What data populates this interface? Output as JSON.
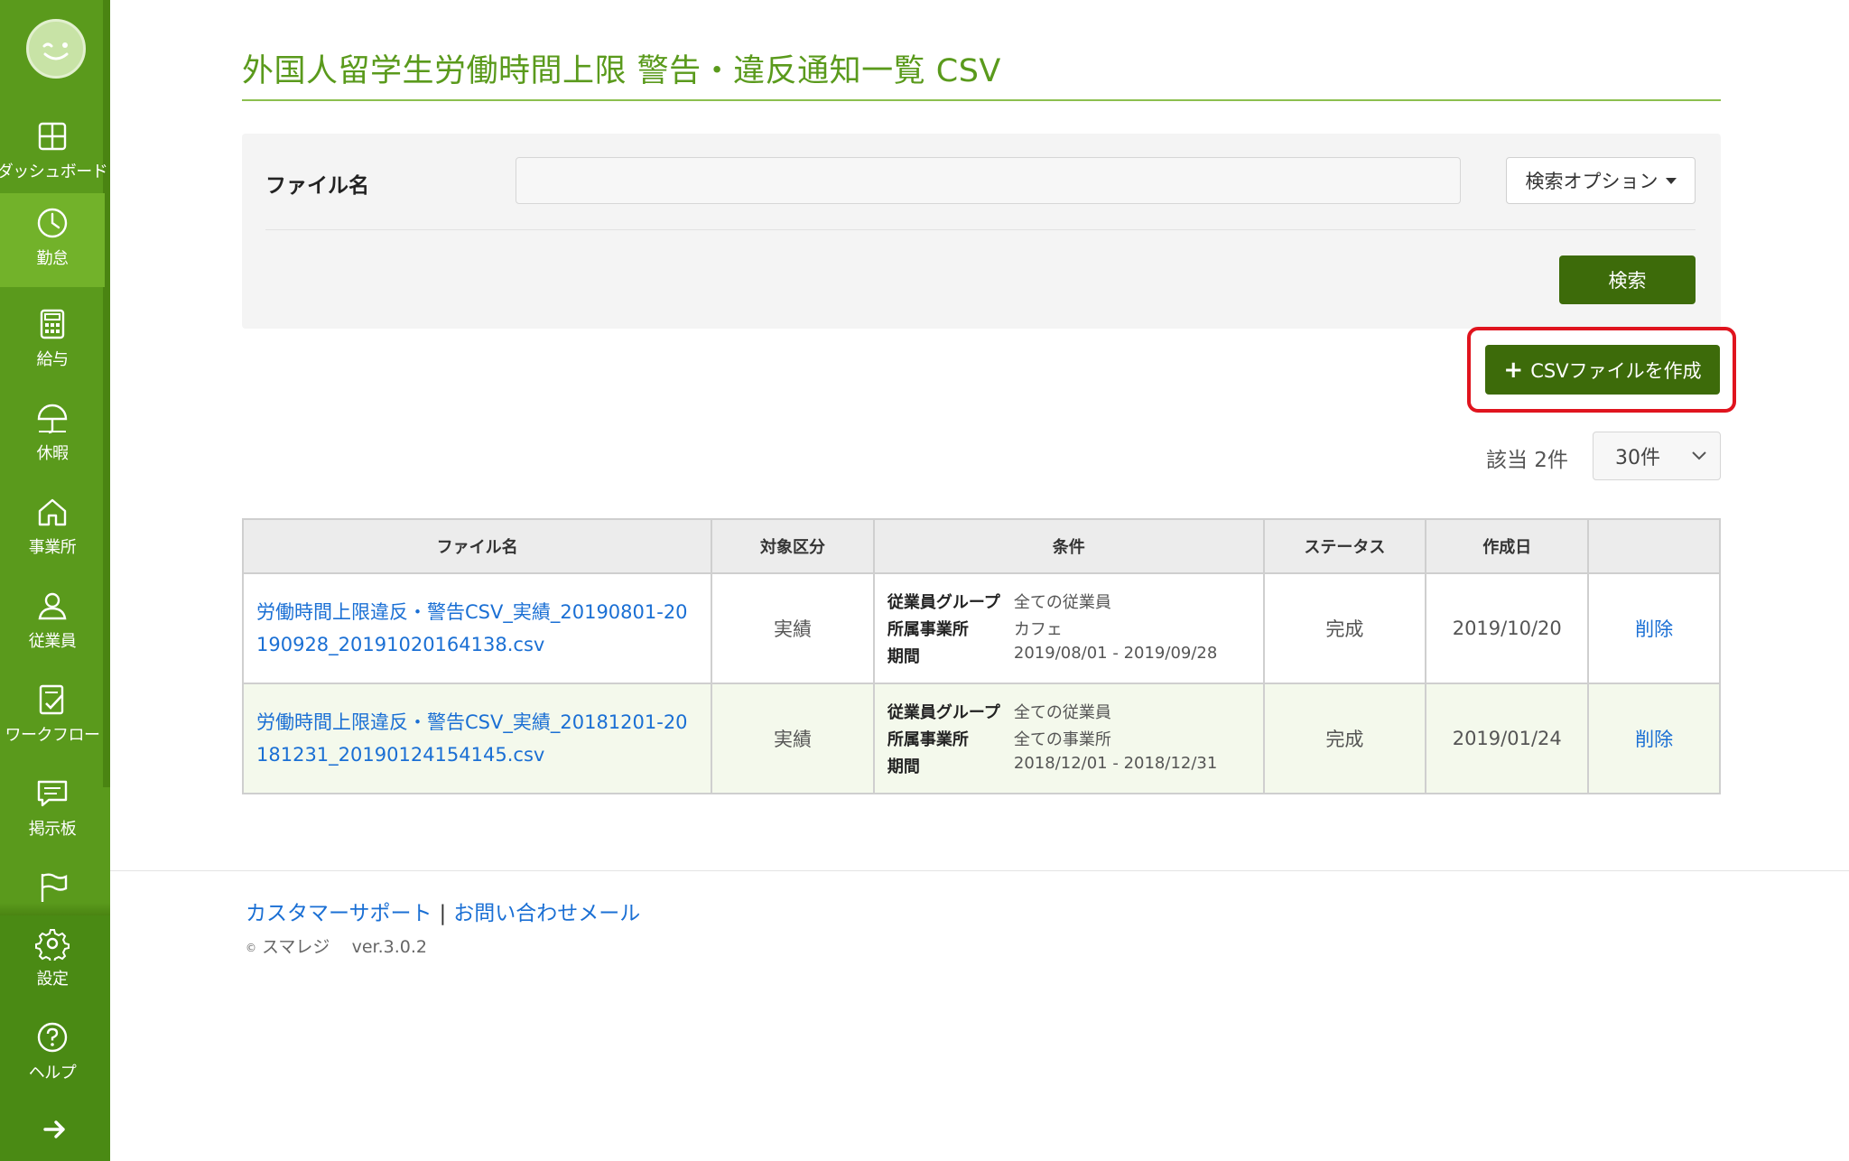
{
  "page": {
    "title": "外国人留学生労働時間上限 警告・違反通知一覧 CSV"
  },
  "sidebar": {
    "items": [
      {
        "label": "ダッシュボード",
        "icon": "dashboard-icon"
      },
      {
        "label": "勤怠",
        "icon": "clock-icon"
      },
      {
        "label": "給与",
        "icon": "calculator-icon"
      },
      {
        "label": "休暇",
        "icon": "umbrella-icon"
      },
      {
        "label": "事業所",
        "icon": "home-icon"
      },
      {
        "label": "従業員",
        "icon": "person-icon"
      },
      {
        "label": "ワークフロー",
        "icon": "checklist-icon"
      },
      {
        "label": "掲示板",
        "icon": "message-icon"
      },
      {
        "label": "",
        "icon": "flag-icon"
      },
      {
        "label": "設定",
        "icon": "gear-icon"
      },
      {
        "label": "ヘルプ",
        "icon": "help-icon"
      }
    ],
    "active_index": 1,
    "expand_icon": "arrow-right-icon"
  },
  "search": {
    "label": "ファイル名",
    "input_value": "",
    "options_label": "検索オプション",
    "search_button": "検索"
  },
  "actions": {
    "create_csv": "CSVファイルを作成"
  },
  "results": {
    "count_text": "該当 2件",
    "per_page": "30件"
  },
  "table": {
    "headers": [
      "ファイル名",
      "対象区分",
      "条件",
      "ステータス",
      "作成日",
      ""
    ],
    "rows": [
      {
        "file_name": "労働時間上限違反・警告CSV_実績_20190801-20190928_20191020164138.csv",
        "category": "実績",
        "conditions": [
          {
            "key": "従業員グループ",
            "value": "全ての従業員"
          },
          {
            "key": "所属事業所",
            "value": "カフェ"
          },
          {
            "key": "期間",
            "value": "2019/08/01 - 2019/09/28"
          }
        ],
        "status": "完成",
        "created": "2019/10/20",
        "action": "削除"
      },
      {
        "file_name": "労働時間上限違反・警告CSV_実績_20181201-20181231_20190124154145.csv",
        "category": "実績",
        "conditions": [
          {
            "key": "従業員グループ",
            "value": "全ての従業員"
          },
          {
            "key": "所属事業所",
            "value": "全ての事業所"
          },
          {
            "key": "期間",
            "value": "2018/12/01 - 2018/12/31"
          }
        ],
        "status": "完成",
        "created": "2019/01/24",
        "action": "削除"
      }
    ]
  },
  "footer": {
    "support_link": "カスタマーサポート",
    "separator": "|",
    "contact_link": "お問い合わせメール",
    "copyright_symbol": "©",
    "company": "スマレジ",
    "version": "ver.3.0.2"
  },
  "colors": {
    "sidebar": "#5a9a1c",
    "sidebar_active": "#72b22a",
    "primary_button": "#3d6b0a",
    "link": "#1a6fd4",
    "title": "#5a9a1c",
    "highlight": "#e0141e"
  }
}
